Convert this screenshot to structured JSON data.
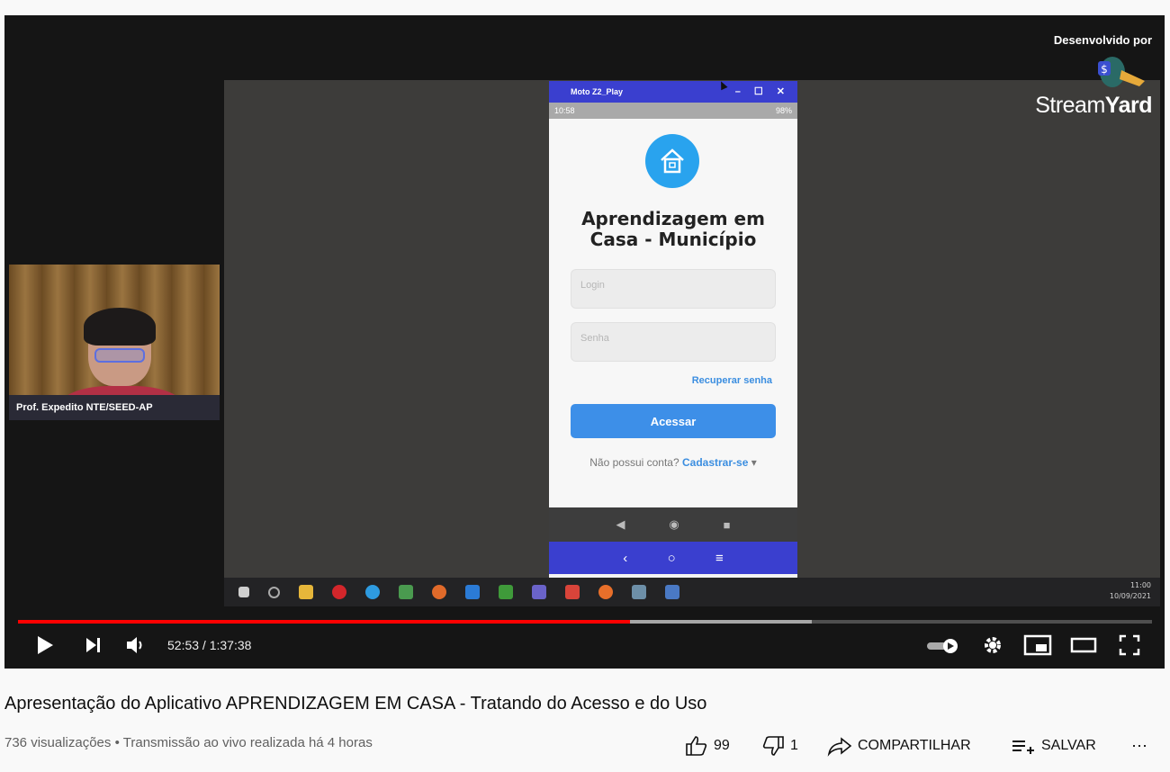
{
  "overlay": {
    "brand_developed_by": "Desenvolvido por",
    "brand_name_light": "Stream",
    "brand_name_bold": "Yard",
    "webcam_name": "Prof. Expedito NTE/SEED-AP"
  },
  "emulator": {
    "window_title": "Moto Z2_Play",
    "status_time": "10:58",
    "status_battery": "98%",
    "app_title_line1": "Aprendizagem em",
    "app_title_line2": "Casa - Município",
    "login_placeholder": "Login",
    "password_placeholder": "Senha",
    "recover_link": "Recuperar senha",
    "login_button": "Acessar",
    "signup_prompt": "Não possui conta?",
    "signup_link": "Cadastrar-se"
  },
  "desktop": {
    "clock_time": "11:00",
    "clock_date": "10/09/2021"
  },
  "player": {
    "current_time": "52:53",
    "duration": "1:37:38",
    "time_display": "52:53 / 1:37:38",
    "progress_played_fraction": 0.54,
    "progress_buffered_fraction": 0.7,
    "accent_color": "#ff0000"
  },
  "video": {
    "title": "Apresentação do Aplicativo APRENDIZAGEM EM CASA - Tratando do Acesso e do Uso",
    "views": "736 visualizações",
    "separator": "•",
    "stream_info": "Transmissão ao vivo realizada há 4 horas",
    "likes": "99",
    "dislikes": "1",
    "share_label": "COMPARTILHAR",
    "save_label": "SALVAR"
  }
}
